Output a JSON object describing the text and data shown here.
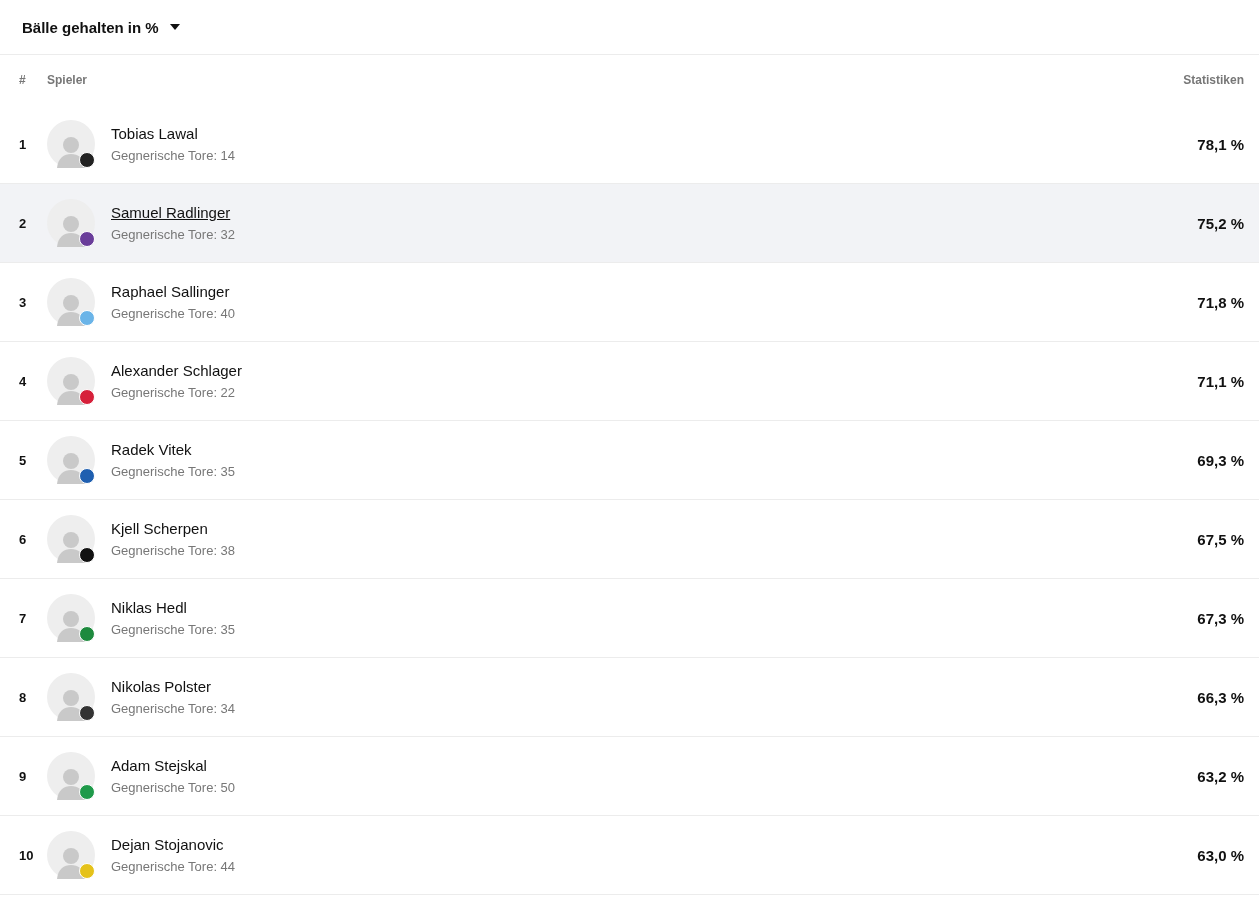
{
  "stat_selector": {
    "label": "Bälle gehalten in %"
  },
  "table": {
    "columns": [
      "#",
      "Spieler",
      "Statistiken"
    ],
    "rows": [
      {
        "rank": "1",
        "name": "Tobias Lawal",
        "detail": "Gegnerische Tore: 14",
        "value": "78,1 %",
        "selected": false,
        "color": "#222222"
      },
      {
        "rank": "2",
        "name": "Samuel Radlinger",
        "detail": "Gegnerische Tore: 32",
        "value": "75,2 %",
        "selected": true,
        "color": "#6a3d9a"
      },
      {
        "rank": "3",
        "name": "Raphael Sallinger",
        "detail": "Gegnerische Tore: 40",
        "value": "71,8 %",
        "selected": false,
        "color": "#6ab4e8"
      },
      {
        "rank": "4",
        "name": "Alexander Schlager",
        "detail": "Gegnerische Tore: 22",
        "value": "71,1 %",
        "selected": false,
        "color": "#d6203a"
      },
      {
        "rank": "5",
        "name": "Radek Vitek",
        "detail": "Gegnerische Tore: 35",
        "value": "69,3 %",
        "selected": false,
        "color": "#1f5fb0"
      },
      {
        "rank": "6",
        "name": "Kjell Scherpen",
        "detail": "Gegnerische Tore: 38",
        "value": "67,5 %",
        "selected": false,
        "color": "#111111"
      },
      {
        "rank": "7",
        "name": "Niklas Hedl",
        "detail": "Gegnerische Tore: 35",
        "value": "67,3 %",
        "selected": false,
        "color": "#1e8a3e"
      },
      {
        "rank": "8",
        "name": "Nikolas Polster",
        "detail": "Gegnerische Tore: 34",
        "value": "66,3 %",
        "selected": false,
        "color": "#333333"
      },
      {
        "rank": "9",
        "name": "Adam Stejskal",
        "detail": "Gegnerische Tore: 50",
        "value": "63,2 %",
        "selected": false,
        "color": "#1f9a4a"
      },
      {
        "rank": "10",
        "name": "Dejan Stojanovic",
        "detail": "Gegnerische Tore: 44",
        "value": "63,0 %",
        "selected": false,
        "color": "#e5c21a"
      }
    ]
  }
}
